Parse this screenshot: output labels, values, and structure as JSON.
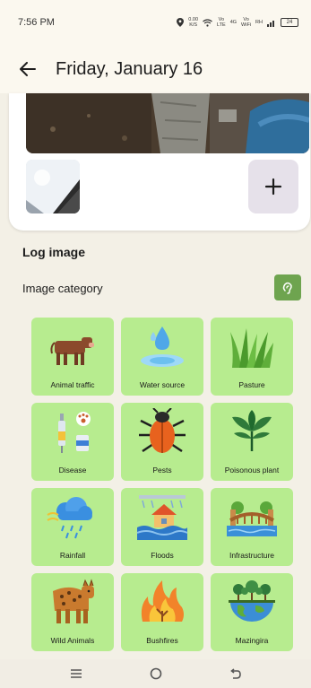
{
  "status": {
    "time": "7:56 PM",
    "data_rate": "0.00",
    "data_unit": "K/S",
    "net1_top": "Vo",
    "net1_bottom": "LTE",
    "net2": "4G",
    "net3_top": "Vo",
    "net3_bottom": "WiFi",
    "net4": "RH",
    "battery": "24"
  },
  "appbar": {
    "title": "Friday, January 16"
  },
  "log": {
    "title": "Log image",
    "category_label": "Image category"
  },
  "categories": [
    {
      "label": "Animal traffic",
      "icon": "cow-icon"
    },
    {
      "label": "Water source",
      "icon": "water-drop-icon"
    },
    {
      "label": "Pasture",
      "icon": "grass-icon"
    },
    {
      "label": "Disease",
      "icon": "vaccine-icon"
    },
    {
      "label": "Pests",
      "icon": "beetle-icon"
    },
    {
      "label": "Poisonous plant",
      "icon": "plant-icon"
    },
    {
      "label": "Rainfall",
      "icon": "rain-cloud-icon"
    },
    {
      "label": "Floods",
      "icon": "flood-house-icon"
    },
    {
      "label": "Infrastructure",
      "icon": "bridge-icon"
    },
    {
      "label": "Wild Animals",
      "icon": "hyena-icon"
    },
    {
      "label": "Bushfires",
      "icon": "fire-icon"
    },
    {
      "label": "Mazingira",
      "icon": "globe-trees-icon"
    }
  ],
  "colors": {
    "tile": "#b7ec8f",
    "accent": "#6ea44f",
    "background": "#f3f0e6"
  }
}
